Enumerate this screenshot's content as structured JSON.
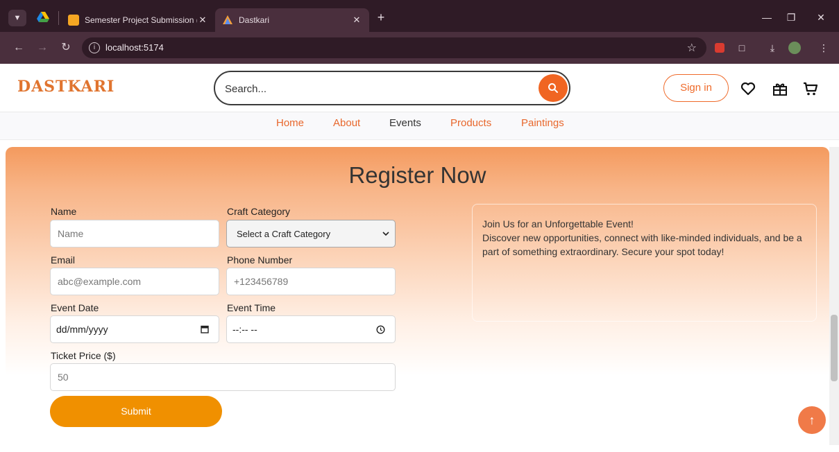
{
  "browser": {
    "tabs": [
      {
        "title": "Semester Project Submission (L",
        "active": false
      },
      {
        "title": "Dastkari",
        "active": true
      }
    ],
    "url": "localhost:5174"
  },
  "header": {
    "logo": "DASTKARI",
    "search_placeholder": "Search...",
    "signin_label": "Sign in"
  },
  "nav": {
    "items": [
      "Home",
      "About",
      "Events",
      "Products",
      "Paintings"
    ],
    "current": "Events"
  },
  "form": {
    "title": "Register Now",
    "name_label": "Name",
    "name_placeholder": "Name",
    "craft_label": "Craft Category",
    "craft_selected": "Select a Craft Category",
    "email_label": "Email",
    "email_placeholder": "abc@example.com",
    "phone_label": "Phone Number",
    "phone_placeholder": "+123456789",
    "date_label": "Event Date",
    "date_value": "dd/mm/yyyy",
    "time_label": "Event Time",
    "time_value": "--:-- --",
    "price_label": "Ticket Price ($)",
    "price_placeholder": "50",
    "submit_label": "Submit"
  },
  "info": {
    "heading": "Join Us for an Unforgettable Event!",
    "body": "Discover new opportunities, connect with like-minded individuals, and be a part of something extraordinary. Secure your spot today!"
  },
  "colors": {
    "brand": "#e0742f",
    "accent": "#f06522",
    "submit": "#f09000"
  }
}
